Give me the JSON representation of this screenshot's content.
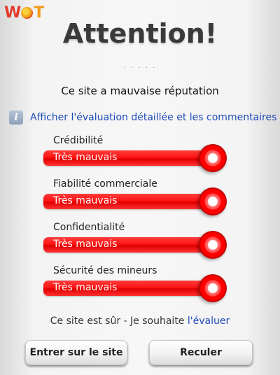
{
  "logo": {
    "w": "W",
    "o": "O",
    "t": "T"
  },
  "title": "Attention!",
  "dots": "· · · · ·",
  "subtitle": "Ce site a mauvaise réputation",
  "details_link": "Afficher l'évaluation détaillée et les commentaires",
  "info_icon": "i",
  "ratings": [
    {
      "label": "Crédibilité",
      "value": "Très mauvais"
    },
    {
      "label": "Fiabilité commerciale",
      "value": "Très mauvais"
    },
    {
      "label": "Confidentialité",
      "value": "Très mauvais"
    },
    {
      "label": "Sécurité des mineurs",
      "value": "Très mauvais"
    }
  ],
  "safe_text": "Ce site est sûr - Je souhaite ",
  "safe_link": "l'évaluer",
  "buttons": {
    "enter": "Entrer sur le site",
    "back": "Reculer"
  },
  "colors": {
    "rating_red": "#ff1414",
    "link_blue": "#1d4bb8"
  }
}
